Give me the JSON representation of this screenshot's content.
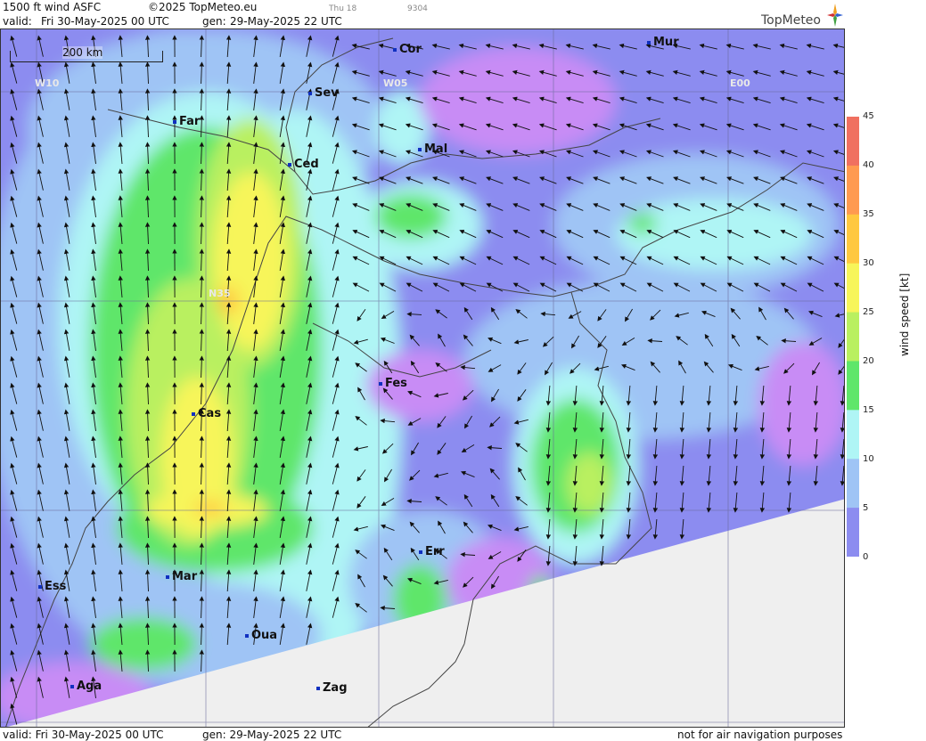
{
  "header": {
    "product": "1500 ft wind ASFC",
    "copyright": "©2025 TopMeteo.eu",
    "run_day": "Thu 18",
    "code": "9304",
    "valid_label": "valid:",
    "valid_value": "Fri  30-May-2025  00 UTC",
    "gen_label": "gen:",
    "gen_value": "29-May-2025 22 UTC",
    "logo_text": "TopMeteo"
  },
  "scale_bar": {
    "label": "200 km"
  },
  "grid_labels": [
    "W10",
    "W05",
    "E00",
    "N35"
  ],
  "cities": [
    {
      "name": "Cor"
    },
    {
      "name": "Mur"
    },
    {
      "name": "Sev"
    },
    {
      "name": "Far"
    },
    {
      "name": "Mal"
    },
    {
      "name": "Ced"
    },
    {
      "name": "Fes"
    },
    {
      "name": "Cas"
    },
    {
      "name": "Err"
    },
    {
      "name": "Ess"
    },
    {
      "name": "Mar"
    },
    {
      "name": "Oua"
    },
    {
      "name": "Aga"
    },
    {
      "name": "Zag"
    }
  ],
  "legend": {
    "title": "wind speed [kt]",
    "ticks": [
      "45",
      "40",
      "35",
      "30",
      "25",
      "20",
      "15",
      "10",
      "5",
      "0"
    ],
    "colors": {
      "0": "#c88cf5",
      "5": "#8c8cf0",
      "10": "#9fc4f5",
      "15": "#aff5f5",
      "20": "#5fe66a",
      "25": "#b9f060",
      "30": "#f7f55a",
      "35": "#ffc840",
      "40": "#ff9a50",
      "45": "#f07060"
    }
  },
  "footer": {
    "valid": "valid:  Fri  30-May-2025  00 UTC",
    "gen": "gen: 29-May-2025 22 UTC",
    "disclaimer": "not for air navigation purposes"
  }
}
